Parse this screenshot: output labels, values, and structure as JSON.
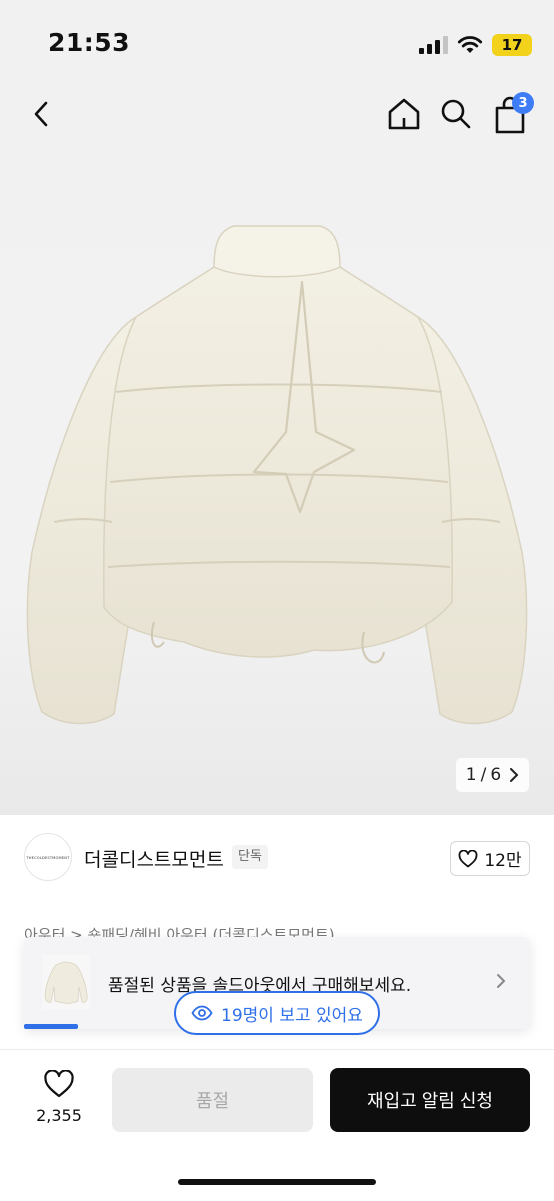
{
  "status_bar": {
    "time": "21:53",
    "battery": "17"
  },
  "header": {
    "cart_count": "3"
  },
  "gallery": {
    "current": "1",
    "separator": "/",
    "total": "6"
  },
  "brand": {
    "name": "더콜디스트모먼트",
    "tag": "단독",
    "logo_text": "THECOLDESTMOMENT",
    "likes": "12만"
  },
  "breadcrumb": "아우터 > 숏패딩/헤비 아우터 (더콜디스트모먼트)",
  "banner": {
    "text": "품절된 상품을 솔드아웃에서 구매해보세요."
  },
  "viewers": {
    "text": "19명이 보고 있어요"
  },
  "bottom": {
    "wish_count": "2,355",
    "soldout_label": "품절",
    "restock_label": "재입고 알림 신청"
  },
  "colors": {
    "accent": "#2f6fe8",
    "badge": "#3f7df7",
    "battery": "#f2d21b",
    "primary_button": "#0e0e0e"
  },
  "icons": [
    "back-arrow-icon",
    "home-icon",
    "search-icon",
    "shopping-bag-icon",
    "chevron-right-icon",
    "heart-icon",
    "eye-icon",
    "wifi-icon",
    "cellular-signal-icon"
  ]
}
